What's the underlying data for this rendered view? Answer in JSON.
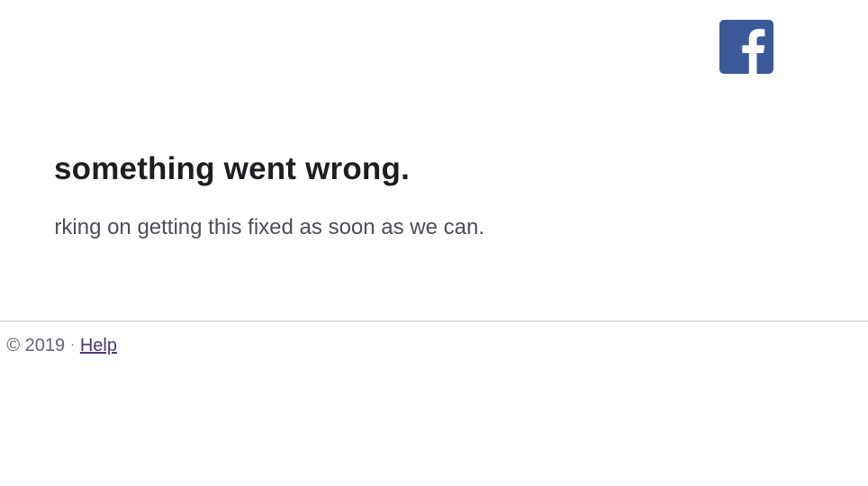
{
  "brand": {
    "logo_icon": "facebook-icon",
    "logo_color": "#3b5998"
  },
  "error": {
    "heading": "something went wrong.",
    "message": "rking on getting this fixed as soon as we can."
  },
  "footer": {
    "copyright": "© 2019",
    "separator": "·",
    "help_label": "Help"
  },
  "colors": {
    "heading": "#1c1e21",
    "text": "#4b4f56",
    "link": "#4b367c",
    "divider": "#dddfe2"
  }
}
